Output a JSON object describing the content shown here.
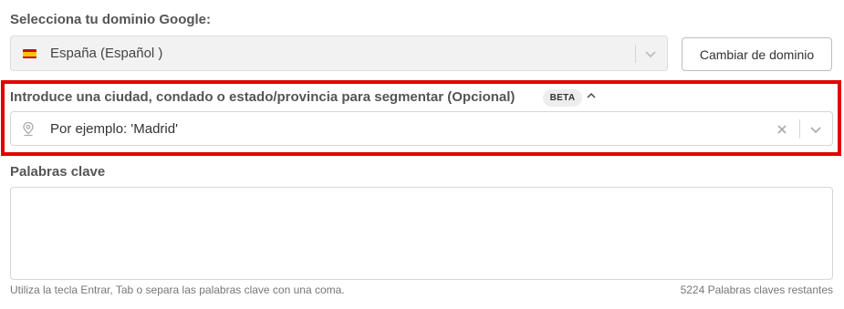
{
  "domain_section": {
    "label": "Selecciona tu dominio Google:",
    "selected_domain": "España (Español )",
    "flag_icon": "spain-flag-icon",
    "change_button": "Cambiar de dominio"
  },
  "location_section": {
    "label": "Introduce una ciudad, condado o estado/provincia para segmentar (Opcional)",
    "badge": "BETA",
    "input_placeholder": "Por ejemplo: 'Madrid'",
    "highlight_color": "#e00000"
  },
  "keywords_section": {
    "label": "Palabras clave",
    "value": "",
    "help_text": "Utiliza la tecla Entrar, Tab o separa las palabras clave con una coma.",
    "remaining_text": "5224 Palabras claves restantes"
  }
}
